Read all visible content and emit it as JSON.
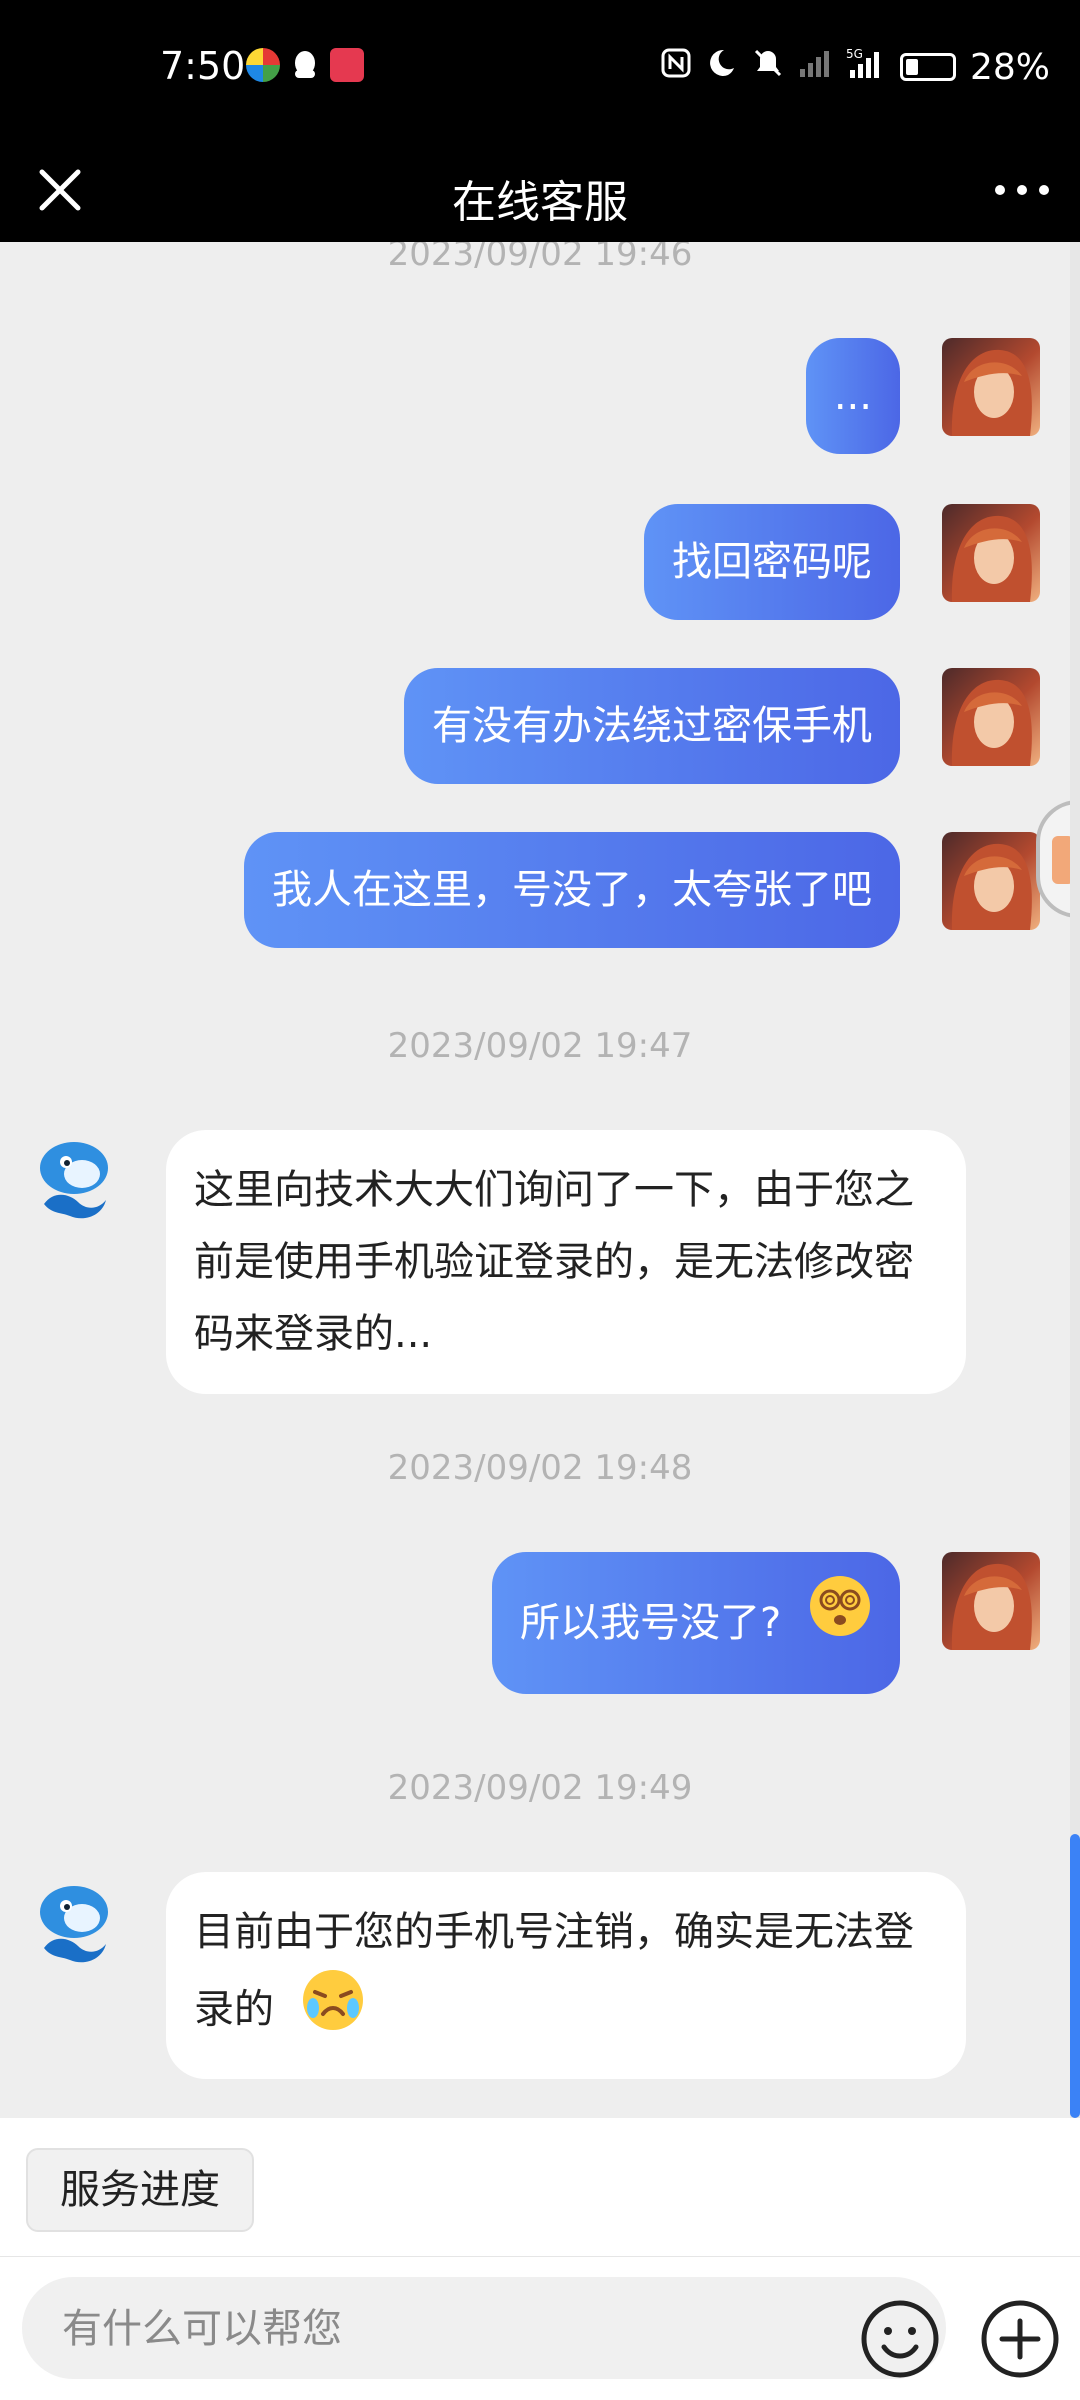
{
  "status": {
    "time": "7:50",
    "battery_text": "28%",
    "battery_level": 0.28
  },
  "header": {
    "title": "在线客服"
  },
  "messages": [
    {
      "type": "timestamp",
      "text": "2023/09/02 19:46"
    },
    {
      "type": "out",
      "text": "..."
    },
    {
      "type": "out",
      "text": "找回密码呢"
    },
    {
      "type": "out",
      "text": "有没有办法绕过密保手机"
    },
    {
      "type": "out",
      "text": "我人在这里，号没了，太夸张了吧"
    },
    {
      "type": "timestamp",
      "text": "2023/09/02 19:47"
    },
    {
      "type": "in",
      "text": "这里向技术大大们询问了一下，由于您之前是使用手机验证登录的，是无法修改密码来登录的..."
    },
    {
      "type": "timestamp",
      "text": "2023/09/02 19:48"
    },
    {
      "type": "out",
      "text": "所以我号没了?",
      "emoji": "dizzy-face-emoji"
    },
    {
      "type": "timestamp",
      "text": "2023/09/02 19:49"
    },
    {
      "type": "in",
      "text": "目前由于您的手机号注销，确实是无法登录的",
      "emoji": "crying-face-emoji"
    }
  ],
  "quick_actions": {
    "service_progress": "服务进度"
  },
  "input": {
    "placeholder": "有什么可以帮您"
  }
}
